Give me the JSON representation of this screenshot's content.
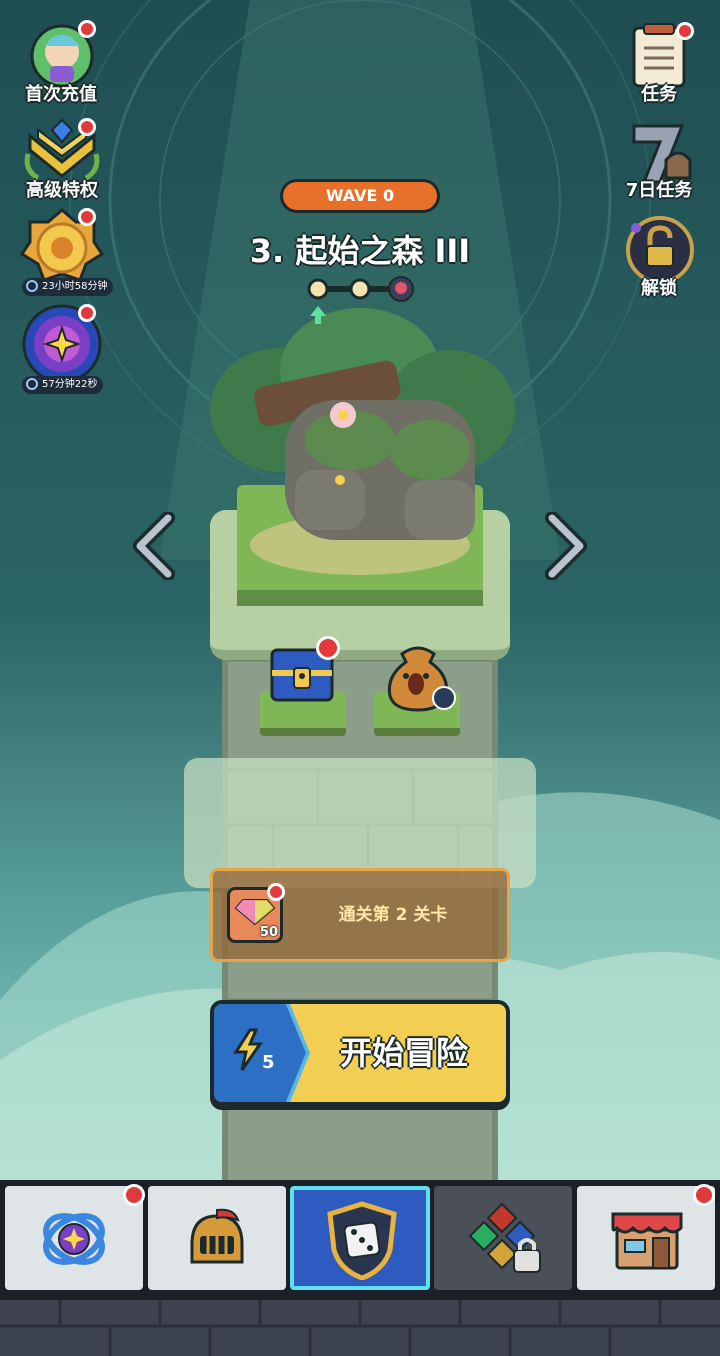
{
  "left_menu": [
    {
      "label": "首次充值",
      "icon": "first-recharge-character-icon",
      "badge": true
    },
    {
      "label": "高级特权",
      "icon": "premium-chevron-gem-icon",
      "badge": true
    },
    {
      "timer": "23小时58分钟",
      "icon": "gold-medal-event-icon",
      "badge": true
    },
    {
      "timer": "57分钟22秒",
      "icon": "purple-portal-star-icon",
      "badge": true
    }
  ],
  "right_menu": [
    {
      "label": "任务",
      "icon": "quest-scroll-icon",
      "badge": true
    },
    {
      "label": "7日任务",
      "icon": "seven-day-helmet-icon",
      "badge": false
    },
    {
      "label": "解锁",
      "icon": "padlock-unlock-icon",
      "badge": false
    }
  ],
  "stage": {
    "wave_label": "WAVE 0",
    "title": "3. 起始之森 III",
    "progress_nodes": 3,
    "boss_icon": "skull-icon"
  },
  "rewards": {
    "chest_icon": "blue-gold-chest-icon",
    "bag_icon": "gold-coin-bag-icon"
  },
  "quest_banner": {
    "text": "通关第 2 关卡",
    "gem_count": "50",
    "icon": "rainbow-gem-icon"
  },
  "start_button": {
    "energy_cost": "5",
    "label": "开始冒险"
  },
  "bottom_nav": [
    {
      "name": "talent",
      "icon": "blue-star-orbit-icon",
      "badge": true,
      "active": false
    },
    {
      "name": "hero",
      "icon": "knight-helmet-icon",
      "badge": false,
      "active": false
    },
    {
      "name": "battle",
      "icon": "dice-shield-icon",
      "badge": false,
      "active": true
    },
    {
      "name": "runes",
      "icon": "locked-gems-icon",
      "badge": false,
      "active": false
    },
    {
      "name": "shop",
      "icon": "shop-stall-icon",
      "badge": true,
      "active": false
    }
  ],
  "colors": {
    "accent_orange": "#e8702a",
    "start_yellow": "#f2cf52",
    "start_blue": "#2c6fc4",
    "badge_red": "#e23a3a"
  }
}
